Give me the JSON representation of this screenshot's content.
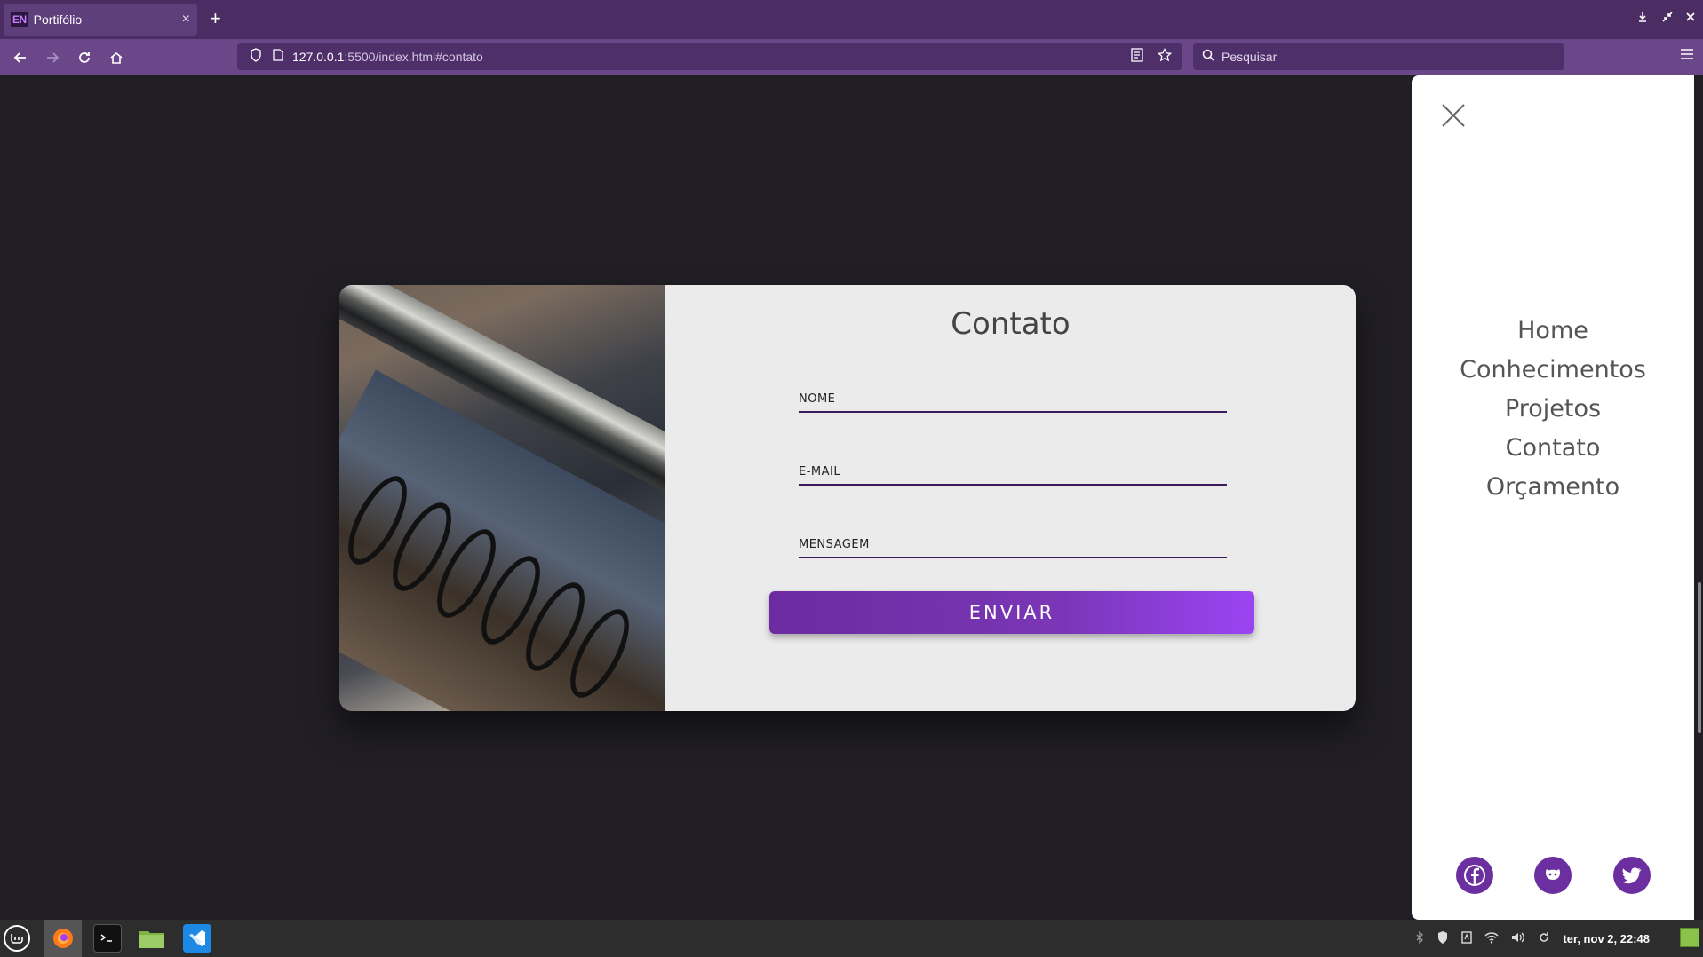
{
  "browser": {
    "tab_badge": "EN",
    "tab_title": "Portifólio",
    "tab_close": "×",
    "new_tab": "+",
    "url_host": "127.0.0.1",
    "url_path": ":5500/index.html#contato",
    "search_placeholder": "Pesquisar"
  },
  "contact": {
    "title": "Contato",
    "name_placeholder": "NOME",
    "email_placeholder": "E-MAIL",
    "message_placeholder": "MENSAGEM",
    "submit_label": "ENVIAR"
  },
  "sidemenu": {
    "links": [
      "Home",
      "Conhecimentos",
      "Projetos",
      "Contato",
      "Orçamento"
    ],
    "socials": [
      "facebook-icon",
      "github-icon",
      "twitter-icon"
    ]
  },
  "taskbar": {
    "clock": "ter, nov  2, 22:48"
  },
  "colors": {
    "accent": "#6b2fa0",
    "chrome_tab": "#4b2d63",
    "chrome_toolbar": "#6b4789",
    "page_bg": "#211f25"
  }
}
